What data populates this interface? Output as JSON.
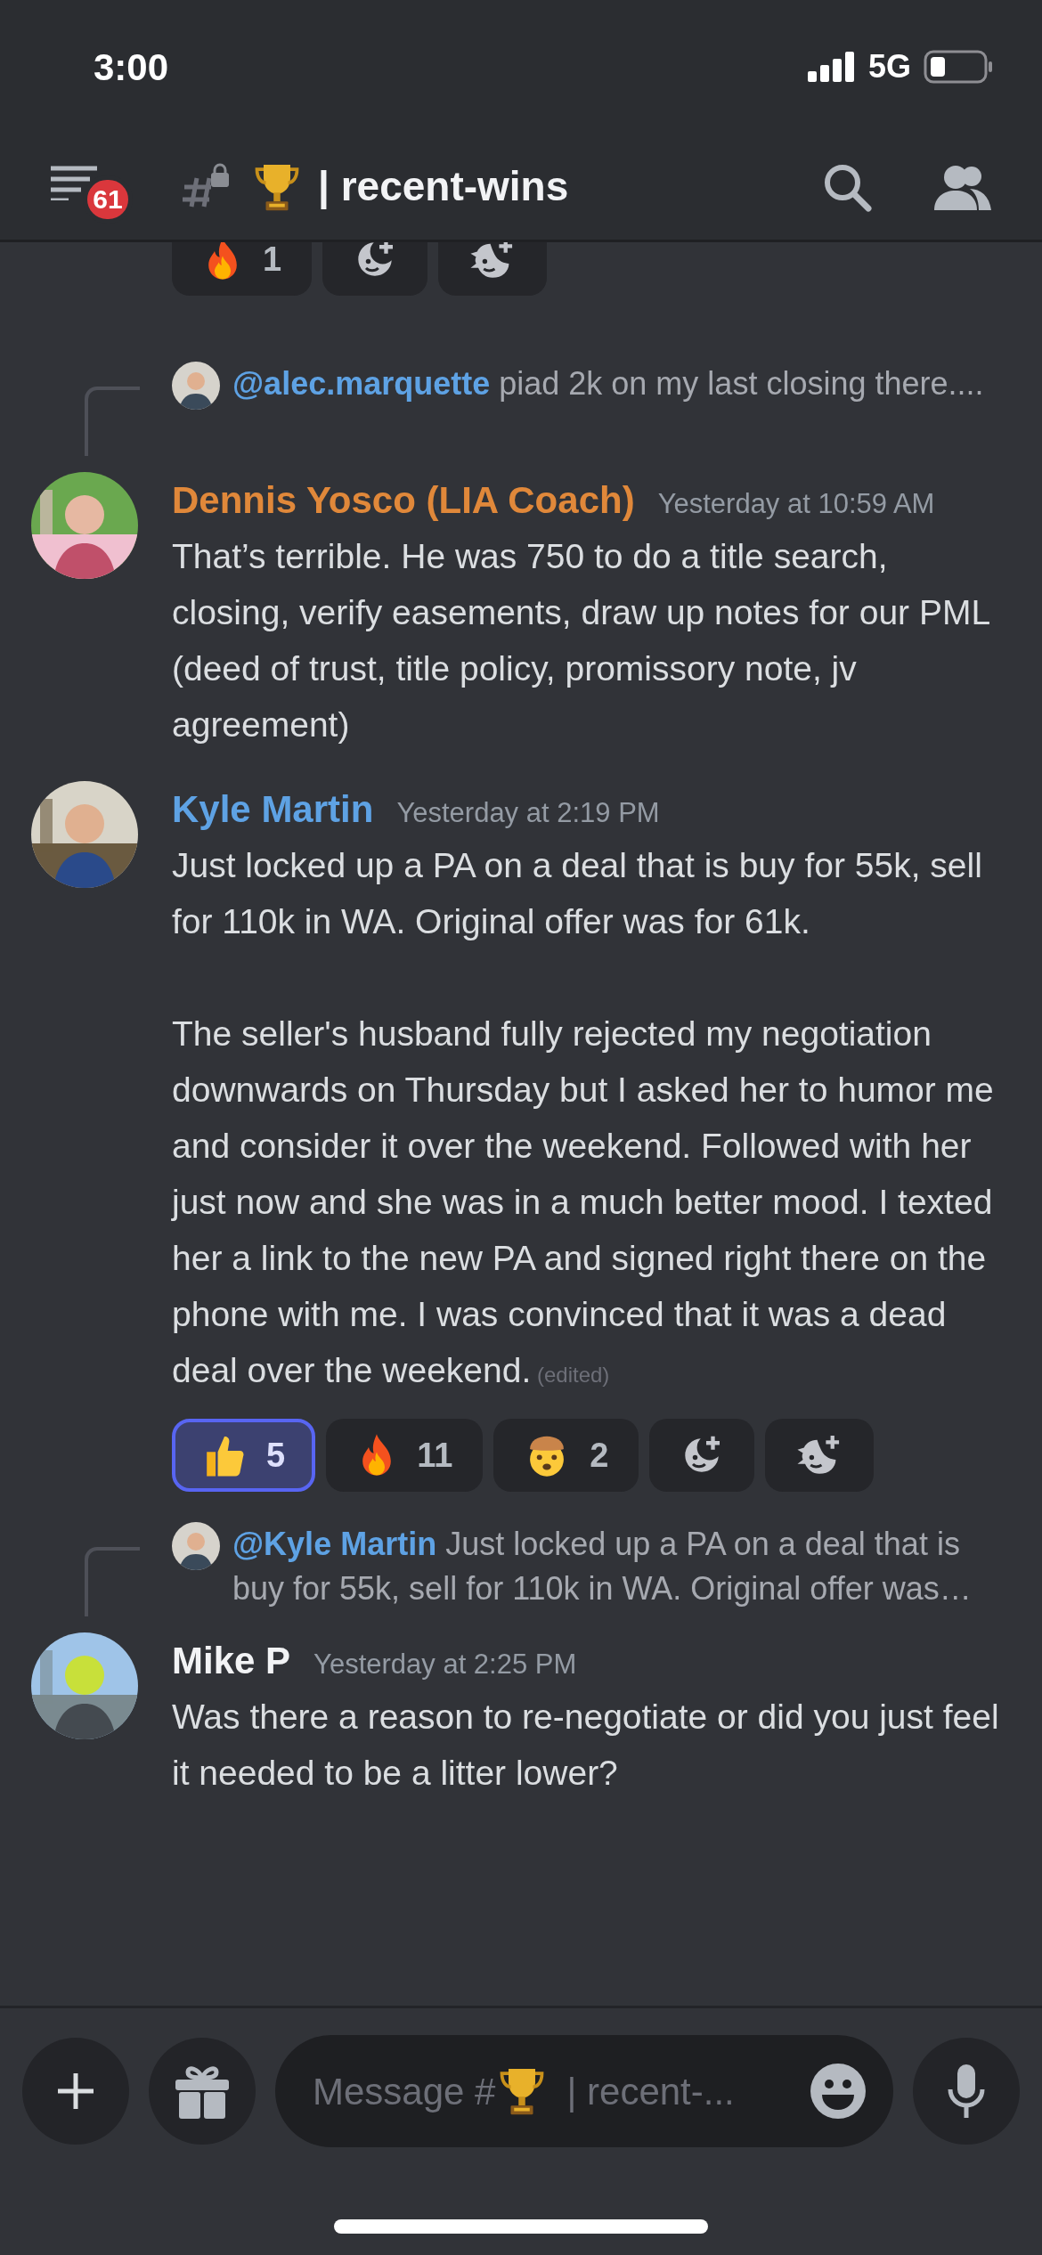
{
  "status_bar": {
    "time": "3:00",
    "network": "5G"
  },
  "header": {
    "unread_badge": "61",
    "channel_name": "| recent-wins"
  },
  "top_reactions": [
    {
      "kind": "fire",
      "count": "1",
      "selected": false
    },
    {
      "kind": "add_reaction"
    },
    {
      "kind": "add_super_reaction"
    }
  ],
  "messages": [
    {
      "reply": {
        "author": "@alec.marquette",
        "text": "piad 2k on my last closing there...."
      },
      "author": "Dennis Yosco (LIA Coach)",
      "color": "#e0883a",
      "timestamp": "Yesterday at 10:59 AM",
      "text": "That’s terrible. He was 750 to do a title search, closing, verify easements, draw up notes for our PML (deed of trust, title policy, promissory note, jv agreement)"
    },
    {
      "author": "Kyle Martin",
      "color": "#5ea2e4",
      "timestamp": "Yesterday at 2:19 PM",
      "text": "Just locked up a PA on a deal that is buy for 55k, sell for 110k in WA. Original offer was for 61k.\n\nThe seller's husband fully rejected my negotiation downwards on Thursday but I asked her to humor me and consider it over the weekend. Followed with her just now and she was in a much better mood. I texted her a link to the new PA and signed right there on the phone with me. I was convinced that it was a dead deal over the weekend.",
      "edited_label": "(edited)",
      "reactions": [
        {
          "kind": "thumbs_up",
          "count": "5",
          "selected": true
        },
        {
          "kind": "fire",
          "count": "11",
          "selected": false
        },
        {
          "kind": "exploding_head",
          "count": "2",
          "selected": false
        },
        {
          "kind": "add_reaction"
        },
        {
          "kind": "add_super_reaction"
        }
      ]
    },
    {
      "reply": {
        "author": "@Kyle Martin",
        "text": "Just locked up a PA on a deal that is buy for 55k, sell for 110k in WA. Original offer was…"
      },
      "author": "Mike P",
      "color": "#f2f3f5",
      "timestamp": "Yesterday at 2:25 PM",
      "text": "Was there a reason to re-negotiate or did you just feel it needed to be a litter lower?"
    }
  ],
  "composer": {
    "placeholder_start": "Message #",
    "placeholder_end": "| recent-..."
  }
}
